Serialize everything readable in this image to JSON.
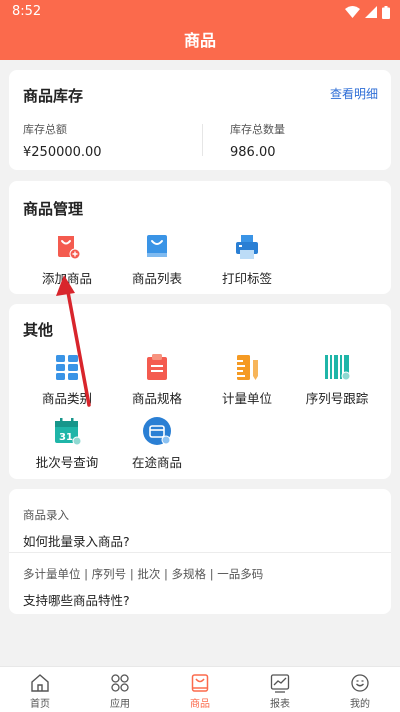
{
  "status_bar": {
    "time": "8:52"
  },
  "header": {
    "title": "商品"
  },
  "stock_card": {
    "title": "商品库存",
    "detail_link": "查看明细",
    "total_amount_label": "库存总额",
    "total_amount_value": "¥250000.00",
    "total_qty_label": "库存总数量",
    "total_qty_value": "986.00"
  },
  "manage_card": {
    "title": "商品管理",
    "items": [
      {
        "label": "添加商品",
        "icon": "add-product-icon"
      },
      {
        "label": "商品列表",
        "icon": "product-list-icon"
      },
      {
        "label": "打印标签",
        "icon": "printer-icon"
      }
    ]
  },
  "other_card": {
    "title": "其他",
    "items": [
      {
        "label": "商品类别",
        "icon": "category-icon"
      },
      {
        "label": "商品规格",
        "icon": "spec-clipboard-icon"
      },
      {
        "label": "计量单位",
        "icon": "unit-ruler-icon"
      },
      {
        "label": "序列号跟踪",
        "icon": "barcode-icon"
      },
      {
        "label": "批次号查询",
        "icon": "calendar-batch-icon"
      },
      {
        "label": "在途商品",
        "icon": "in-transit-icon"
      }
    ]
  },
  "faq": [
    {
      "category": "商品录入",
      "question": "如何批量录入商品?"
    },
    {
      "category": "多计量单位 | 序列号 | 批次 | 多规格 | 一品多码",
      "question": "支持哪些商品特性?"
    }
  ],
  "tabbar": {
    "tabs": [
      {
        "label": "首页",
        "icon": "home-icon"
      },
      {
        "label": "应用",
        "icon": "apps-icon"
      },
      {
        "label": "商品",
        "icon": "goods-bag-icon",
        "active": true
      },
      {
        "label": "报表",
        "icon": "report-chart-icon"
      },
      {
        "label": "我的",
        "icon": "profile-smile-icon"
      }
    ]
  },
  "colors": {
    "accent": "#fb6a4c",
    "link": "#2d6dd6",
    "annotation_arrow": "#d8252c"
  }
}
